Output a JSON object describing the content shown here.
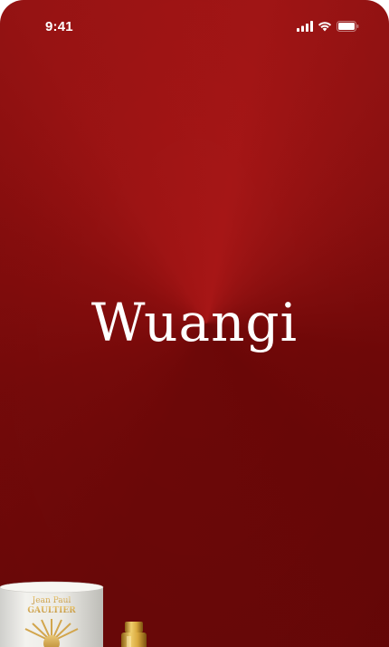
{
  "status_bar": {
    "time": "9:41",
    "icons": [
      "cellular-signal-icon",
      "wifi-icon",
      "battery-icon"
    ]
  },
  "splash": {
    "brand_name": "Wuangi"
  },
  "product_image": {
    "label_line1": "Jean Paul",
    "label_line2": "GAULTIER"
  },
  "colors": {
    "background_dark": "#6e0808",
    "background_light": "#a81616",
    "text": "#ffffff"
  }
}
